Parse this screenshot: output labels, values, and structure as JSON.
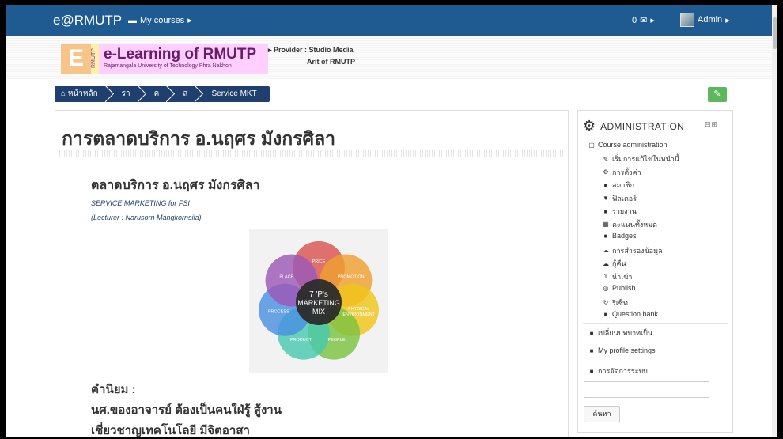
{
  "navbar": {
    "brand": "e@RMUTP",
    "courses_icon": "graduation-cap",
    "courses_label": "My courses",
    "messages_count": "0",
    "messages_icon": "envelope",
    "user_name": "Admin",
    "color": "#1f5a91"
  },
  "header": {
    "logo_letter": "E",
    "logo_vertical": "RMUTP",
    "logo_title": "e-Learning of RMUTP",
    "logo_subtitle": "Rajamangala University of Technology Phra Nakhon",
    "provider_label": "Provider : Studio Media",
    "provider_label2": "Arit of RMUTP"
  },
  "breadcrumb": {
    "items": [
      "หน้าหลัก",
      "รา",
      "ค",
      "ส",
      "Service MKT"
    ],
    "home_icon": "home"
  },
  "edit_button_icon": "edit",
  "main": {
    "title": "การตลาดบริการ อ.นฤศร มังกรศิลา",
    "subtitle": "ตลาดบริการ อ.นฤศร มังกรศิลา",
    "lines": [
      "SERVICE MARKETING for FSI",
      "(Lecturer : Narusorn  Mangkornsila)"
    ],
    "diagram": {
      "center": [
        "7 'P's",
        "MARKETING",
        "MIX"
      ],
      "petals": [
        {
          "label": "PRICE",
          "color": "#d9534f"
        },
        {
          "label": "PROMOTION",
          "color": "#f0a030"
        },
        {
          "label": "PHYSICAL ENVIRONMENT",
          "color": "#f0c419"
        },
        {
          "label": "PEOPLE",
          "color": "#7cc242"
        },
        {
          "label": "PRODUCT",
          "color": "#48c9b0"
        },
        {
          "label": "PROCESS",
          "color": "#4a90e2"
        },
        {
          "label": "PLACE",
          "color": "#9b59b6"
        }
      ]
    },
    "definition": [
      "คำนิยม :",
      "นศ.ของอาจารย์ ต้องเป็นคนใฝ่รู้ สู้งาน",
      "เชี่ยวชาญเทคโนโลยี มีจิตอาสา"
    ]
  },
  "sidebar": {
    "title": "ADMINISTRATION",
    "section": "Course administration",
    "items": [
      {
        "label": "เริ่มการแก้ไขในหน้านี้",
        "icon": "pencil"
      },
      {
        "label": "การตั้งค่า",
        "icon": "gears"
      },
      {
        "label": "สมาชิก",
        "icon": "folder"
      },
      {
        "label": "ฟิลเตอร์",
        "icon": "filter"
      },
      {
        "label": "รายงาน",
        "icon": "folder"
      },
      {
        "label": "คะแนนทั้งหมด",
        "icon": "table"
      },
      {
        "label": "Badges",
        "icon": "folder"
      },
      {
        "label": "การสำรองข้อมูล",
        "icon": "cloud-upload"
      },
      {
        "label": "กู้คืน",
        "icon": "cloud-download"
      },
      {
        "label": "นำเข้า",
        "icon": "upload"
      },
      {
        "label": "Publish",
        "icon": "globe"
      },
      {
        "label": "รีเซ็ท",
        "icon": "refresh"
      },
      {
        "label": "Question bank",
        "icon": "folder"
      }
    ],
    "links": [
      "เปลี่ยนบทบาทเป็น",
      "My profile settings",
      "การจัดการระบบ"
    ],
    "search_button": "ค้นหา",
    "search_placeholder": ""
  }
}
